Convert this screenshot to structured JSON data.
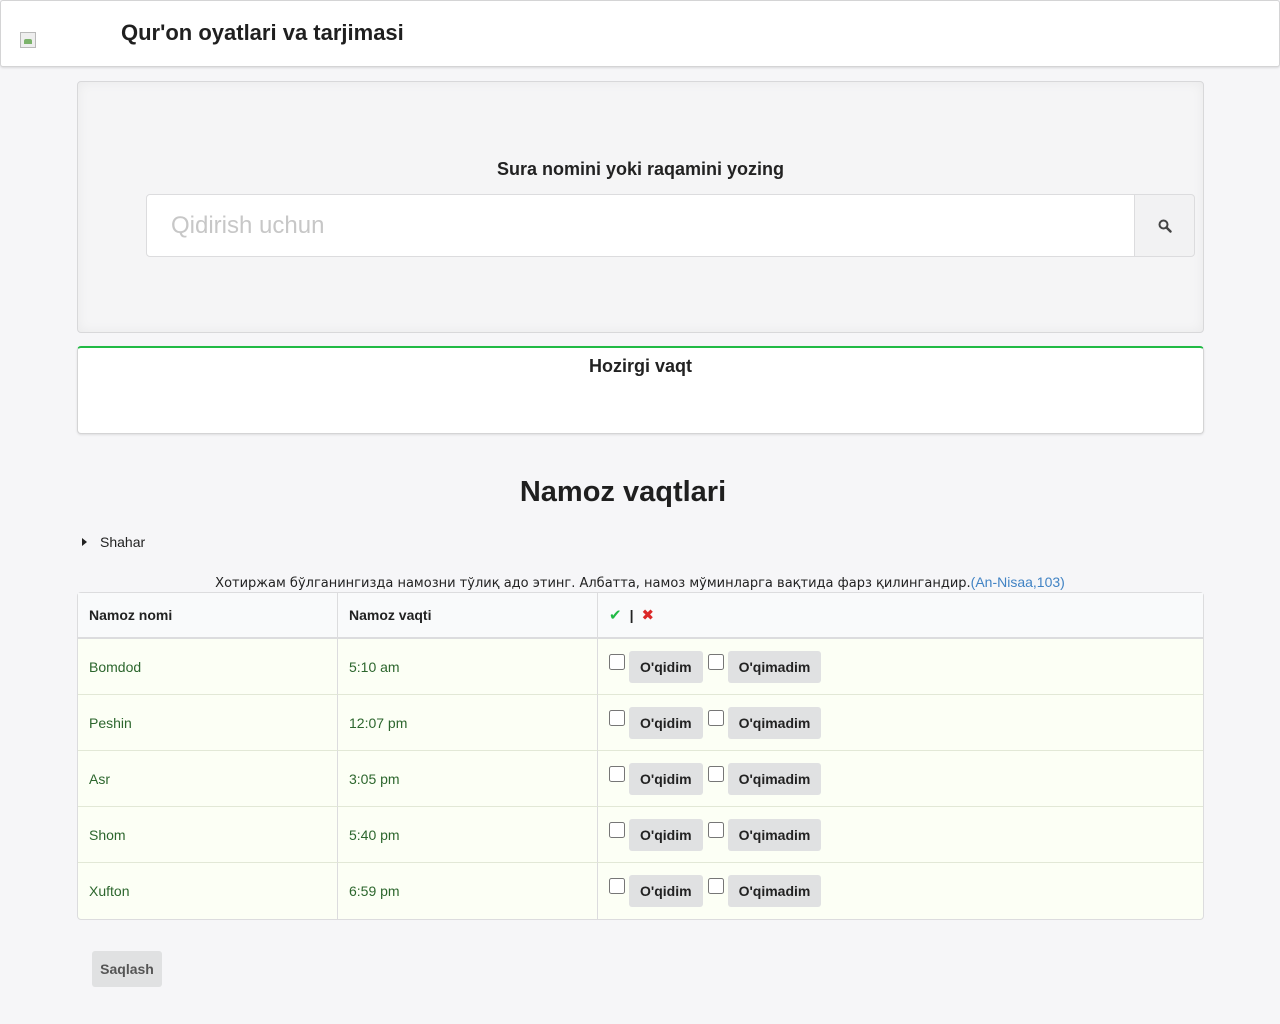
{
  "header": {
    "title": "Qur'on oyatlari va tarjimasi",
    "logo_icon": "broken-image-icon"
  },
  "search": {
    "heading": "Sura nomini yoki raqamini yozing",
    "placeholder": "Qidirish uchun",
    "value": "",
    "button_icon": "search-icon"
  },
  "current_time": {
    "title": "Hozirgi vaqt",
    "value": ""
  },
  "prayer": {
    "section_title": "Namoz vaqtlari",
    "city_label": "Shahar",
    "quote_text": "Хотиржам бўлганингизда намозни тўлиқ адо этинг. Албатта, намоз мўминларга вақтида фарз қилингандир.",
    "quote_ref": "(An-Nisaa,103)",
    "columns": {
      "name": "Namoz nomi",
      "time": "Namoz vaqti",
      "check_symbol": "✔",
      "separator": "|",
      "cross_symbol": "✖"
    },
    "rows": [
      {
        "name": "Bomdod",
        "time": "5:10 am",
        "read_label": "O'qidim",
        "not_read_label": "O'qimadim"
      },
      {
        "name": "Peshin",
        "time": "12:07 pm",
        "read_label": "O'qidim",
        "not_read_label": "O'qimadim"
      },
      {
        "name": "Asr",
        "time": "3:05 pm",
        "read_label": "O'qidim",
        "not_read_label": "O'qimadim"
      },
      {
        "name": "Shom",
        "time": "5:40 pm",
        "read_label": "O'qidim",
        "not_read_label": "O'qimadim"
      },
      {
        "name": "Xufton",
        "time": "6:59 pm",
        "read_label": "O'qidim",
        "not_read_label": "O'qimadim"
      }
    ],
    "save_label": "Saqlash"
  },
  "colors": {
    "accent_green": "#21ba45",
    "row_text_green": "#2c662d",
    "cross_red": "#db2828",
    "link_blue": "#4183c4"
  }
}
